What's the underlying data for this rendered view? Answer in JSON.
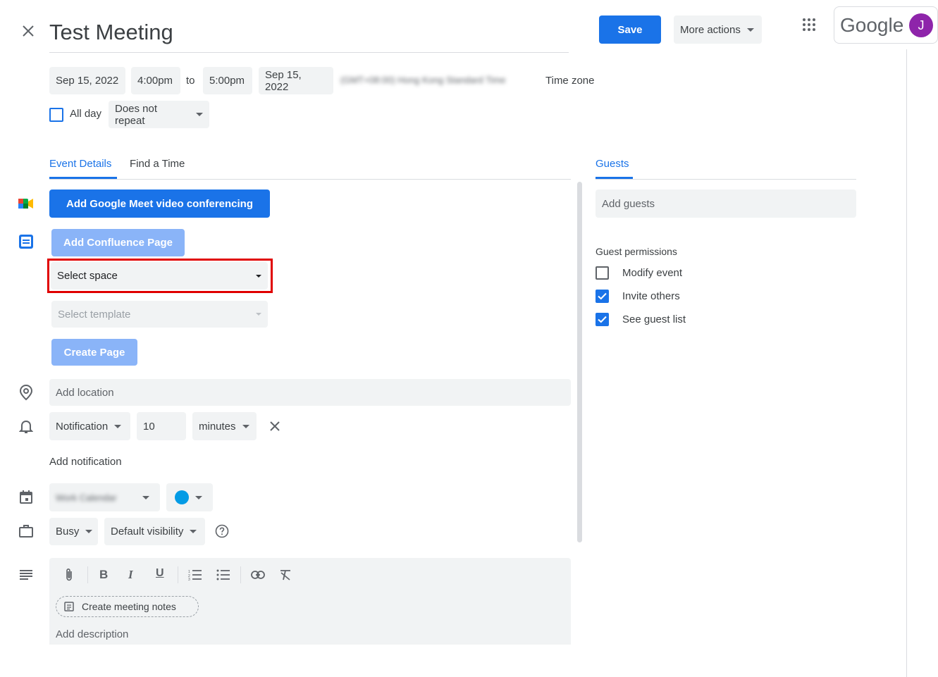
{
  "header": {
    "title": "Test Meeting",
    "save_label": "Save",
    "more_actions_label": "More actions",
    "google_label": "Google",
    "avatar_letter": "J"
  },
  "datetime": {
    "start_date": "Sep 15, 2022",
    "start_time": "4:00pm",
    "to_label": "to",
    "end_time": "5:00pm",
    "end_date": "Sep 15, 2022",
    "timezone_blurred": "(GMT+08:00) Hong Kong Standard Time",
    "timezone_label": "Time zone",
    "all_day_label": "All day",
    "repeat_label": "Does not repeat"
  },
  "tabs": {
    "event_details": "Event Details",
    "find_time": "Find a Time",
    "guests": "Guests"
  },
  "details": {
    "meet_button": "Add Google Meet video conferencing",
    "confluence_button": "Add Confluence Page",
    "select_space": "Select space",
    "select_template": "Select template",
    "create_page": "Create Page",
    "location_placeholder": "Add location",
    "notification_type": "Notification",
    "notification_value": "10",
    "notification_unit": "minutes",
    "add_notification": "Add notification",
    "calendar_blurred": "Work Calendar",
    "busy_label": "Busy",
    "visibility_label": "Default visibility",
    "meeting_notes": "Create meeting notes",
    "description_placeholder": "Add description"
  },
  "guests": {
    "add_placeholder": "Add guests",
    "permissions_title": "Guest permissions",
    "permissions": [
      {
        "label": "Modify event",
        "checked": false
      },
      {
        "label": "Invite others",
        "checked": true
      },
      {
        "label": "See guest list",
        "checked": true
      }
    ]
  },
  "colors": {
    "accent": "#1a73e8",
    "accent_light": "#8ab4f8",
    "event_color": "#039be5",
    "avatar": "#8e24aa",
    "highlight": "#e00000"
  }
}
